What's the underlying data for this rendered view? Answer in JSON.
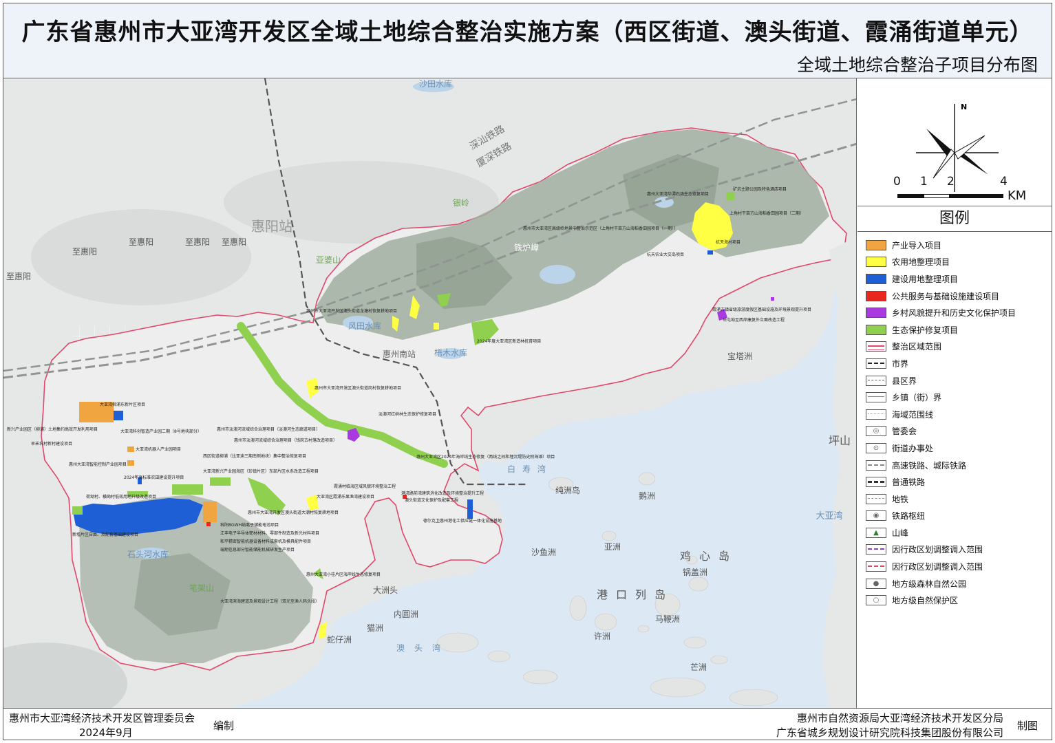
{
  "title": "广东省惠州市大亚湾开发区全域土地综合整治实施方案（西区街道、澳头街道、霞涌街道单元）",
  "subtitle": "全域土地综合整治子项目分布图",
  "colors": {
    "industry": "#f0a540",
    "farmland": "#ffff44",
    "construction": "#1f5fd6",
    "public": "#e8281e",
    "rural": "#a83ae0",
    "ecology": "#8fd14f",
    "boundary": "#e0476a",
    "sea": "#dce8f3"
  },
  "north_label": "N",
  "scale": {
    "ticks": [
      "0",
      "1",
      "2",
      "4"
    ],
    "unit": "KM"
  },
  "legend": {
    "title": "图例",
    "items": [
      {
        "label": "产业导入项目",
        "icon": "fill-industry"
      },
      {
        "label": "农用地整理项目",
        "icon": "fill-farmland"
      },
      {
        "label": "建设用地整理项目",
        "icon": "fill-construction"
      },
      {
        "label": "公共服务与基础设施建设项目",
        "icon": "fill-public"
      },
      {
        "label": "乡村风貌提升和历史文化保护项目",
        "icon": "fill-rural"
      },
      {
        "label": "生态保护修复项目",
        "icon": "fill-ecology"
      },
      {
        "label": "整治区域范围",
        "icon": "line-boundary"
      },
      {
        "label": "市界",
        "icon": "line-city"
      },
      {
        "label": "县区界",
        "icon": "line-county"
      },
      {
        "label": "乡镇（街）界",
        "icon": "line-town"
      },
      {
        "label": "海域范围线",
        "icon": "line-sea"
      },
      {
        "label": "管委会",
        "icon": "symbol-committee"
      },
      {
        "label": "街道办事处",
        "icon": "symbol-office"
      },
      {
        "label": "高速铁路、城际铁路",
        "icon": "line-hsr"
      },
      {
        "label": "普通铁路",
        "icon": "line-rail"
      },
      {
        "label": "地铁",
        "icon": "line-metro"
      },
      {
        "label": "铁路枢纽",
        "icon": "symbol-hub"
      },
      {
        "label": "山峰",
        "icon": "symbol-peak"
      },
      {
        "label": "因行政区划调整调入范围",
        "icon": "line-adj-in"
      },
      {
        "label": "因行政区划调整调入范围",
        "icon": "line-adj-in2"
      },
      {
        "label": "地方级森林自然公园",
        "icon": "symbol-forest"
      },
      {
        "label": "地方级自然保护区",
        "icon": "symbol-reserve"
      }
    ]
  },
  "map": {
    "place_labels": [
      "沙田水库",
      "深汕铁路",
      "厦深铁路",
      "银岭",
      "惠阳站",
      "至惠阳",
      "至惠阳",
      "至惠阳",
      "至惠阳",
      "至惠阳",
      "亚婆山",
      "铁炉嶂",
      "风田水库",
      "梧木水库",
      "惠州南站",
      "宝塔洲",
      "白寿湾",
      "纯洲岛",
      "鹅洲",
      "沙鱼洲",
      "亚洲",
      "鸡心岛",
      "锅盖洲",
      "港口列岛",
      "马鞭洲",
      "许洲",
      "芒洲",
      "大洲头",
      "内圆洲",
      "猫洲",
      "蛇仔洲",
      "澳头湾",
      "笔架山",
      "石头河水库",
      "坪山",
      "大亚湾"
    ],
    "project_labels": [
      "惠州大亚湾华潭石场生态修复项目",
      "矿坑主题公园及特色酒店项目",
      "上角村干亩方山海稻香田园项目（二期）",
      "惠州市大亚湾区高级岭地景中整治示范区（上角村干亩方山海稻香田园项目（一期））",
      "杭天海村项目",
      "杭天农业大交岛项目",
      "霞涌古镇省级旅游度假区基础设施及环境景观提升项目",
      "岳屯坳至西岸康复外立面改造工程",
      "惠州市大亚湾开发区澳头街道龙塘村恢复耕地项目",
      "2024年度大亚湾区新造林抚育项目",
      "惠州市大亚湾开发区澳头街道岗村恢复耕地项目",
      "大亚湾柳浦东新片区项目",
      "淡澳河红树林生态保护修复项目",
      "新兴产业园区（柳浦）土地集约高效开发利用项目",
      "大亚湾科创智造产业园二期（8号地块部分）",
      "惠州市淡澳河流域综合治理项目（淡澳河生态廊道项目）",
      "惠州市淡澳河流域综合治理项目（钱岗古村落改造项目）",
      "早禾坑村新村建设项目",
      "大亚湾机器人产业园项目",
      "西区街道柳浦（比亚迪三期南侧地块）集中整治恢复项目",
      "惠州大亚湾智能控制产业园项目",
      "大亚湾新兴产业园海区（珍镇片区）东部片区水系改造工程项目",
      "2024年高标准农田建设提升项目",
      "惠州大亚湾区2024年海岸线生态修复（两线之间和埋沉堤防史附海滩）项目",
      "荷坳村、横坳村低效用地升级改造项目",
      "新墟片区自由、及配套基础建设项目",
      "霞涌村临海区域风貌环境整治工程",
      "大亚湾区霞涌乐果渔湾建设项目",
      "港湾路前湾建筑消化改造及环境整治提升工程",
      "澳头街道文化保护及配套工程",
      "惠州市大亚湾开发区澳头街道大潮村恢复耕地项目",
      "科阳BGWH纳离子储能电池项目",
      "江丰电子半导体靶材材料、零部件制造及新光材料项目",
      "和平精密智能机器设备材料成套机及模具配件项目",
      "瑞翔信息部分智能储能机械研发生产项目",
      "惠州大亚湾小桂片区海岸线生态修复项目",
      "大亚湾滨海碧道及景观设计工程（双光至渔人码头段）",
      "德尔克卫惠州港化工供应链一体化设施基地"
    ]
  },
  "footer": {
    "org": "惠州市大亚湾经济技术开发区管理委员会",
    "date": "2024年9月",
    "compile": "编制",
    "producer1": "惠州市自然资源局大亚湾经济技术开发区分局",
    "producer2": "广东省城乡规划设计研究院科技集团股份有限公司",
    "made": "制图"
  }
}
